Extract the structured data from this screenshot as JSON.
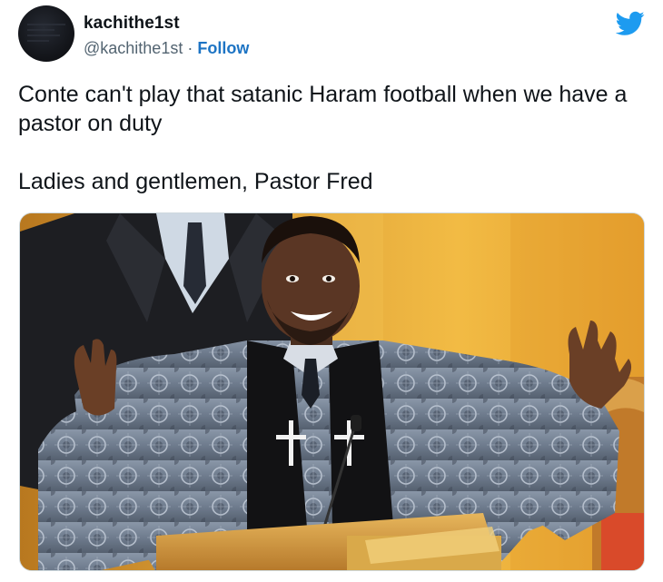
{
  "tweet": {
    "display_name": "kachithe1st",
    "handle": "@kachithe1st",
    "separator": " · ",
    "follow_label": "Follow",
    "text_line_1": "Conte can't play that satanic Haram football when we have a pastor on duty",
    "text_line_2": "Ladies and gentlemen, Pastor Fred"
  },
  "icons": {
    "brand": "twitter-bird-icon",
    "avatar": "avatar-image"
  },
  "colors": {
    "twitter_blue": "#1d9bf0",
    "follow_link": "#1d74c4",
    "text_primary": "#0f1419",
    "text_secondary": "#536471"
  }
}
